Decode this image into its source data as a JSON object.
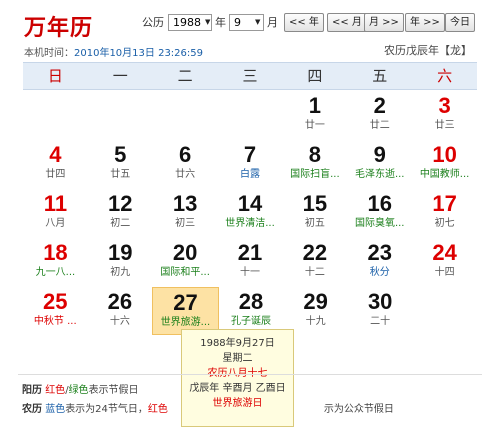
{
  "app": {
    "title": "万年历",
    "now_label": "本机时间：",
    "now_value": "2010年10月13日 23:26:59",
    "lunar_year": "农历戊辰年【龙】"
  },
  "controls": {
    "calendar_label": "公历",
    "year_value": "1988",
    "year_unit": "年",
    "month_value": "9",
    "month_unit": "月",
    "prev_year": "<< 年",
    "next_year": "年 >>",
    "prev_month": "<< 月",
    "next_month": "月 >>",
    "today": "今日"
  },
  "weekdays": [
    "日",
    "一",
    "二",
    "三",
    "四",
    "五",
    "六"
  ],
  "weeks": [
    [
      {
        "d": "",
        "l": ""
      },
      {
        "d": "",
        "l": ""
      },
      {
        "d": "",
        "l": ""
      },
      {
        "d": "",
        "l": ""
      },
      {
        "d": "1",
        "l": "廿一"
      },
      {
        "d": "2",
        "l": "廿二"
      },
      {
        "d": "3",
        "l": "廿三"
      }
    ],
    [
      {
        "d": "4",
        "l": "廿四"
      },
      {
        "d": "5",
        "l": "廿五"
      },
      {
        "d": "6",
        "l": "廿六"
      },
      {
        "d": "7",
        "l": "白露"
      },
      {
        "d": "8",
        "l": "国际扫盲..."
      },
      {
        "d": "9",
        "l": "毛泽东逝..."
      },
      {
        "d": "10",
        "l": "中国教师..."
      }
    ],
    [
      {
        "d": "11",
        "l": "八月"
      },
      {
        "d": "12",
        "l": "初二"
      },
      {
        "d": "13",
        "l": "初三"
      },
      {
        "d": "14",
        "l": "世界清洁..."
      },
      {
        "d": "15",
        "l": "初五"
      },
      {
        "d": "16",
        "l": "国际臭氧..."
      },
      {
        "d": "17",
        "l": "初七"
      }
    ],
    [
      {
        "d": "18",
        "l": "九一八..."
      },
      {
        "d": "19",
        "l": "初九"
      },
      {
        "d": "20",
        "l": "国际和平..."
      },
      {
        "d": "21",
        "l": "十一"
      },
      {
        "d": "22",
        "l": "十二"
      },
      {
        "d": "23",
        "l": "秋分"
      },
      {
        "d": "24",
        "l": "十四"
      }
    ],
    [
      {
        "d": "25",
        "l": "中秋节 ..."
      },
      {
        "d": "26",
        "l": "十六"
      },
      {
        "d": "27",
        "l": "世界旅游..."
      },
      {
        "d": "28",
        "l": "孔子诞辰"
      },
      {
        "d": "29",
        "l": "十九"
      },
      {
        "d": "30",
        "l": "二十"
      },
      {
        "d": "",
        "l": ""
      }
    ]
  ],
  "lunar_colors": {
    "7": "blue",
    "8": "green",
    "9": "green",
    "10": "green",
    "14": "green",
    "16": "green",
    "18": "green",
    "20": "green",
    "23": "blue",
    "25": "red",
    "27": "green",
    "28": "green"
  },
  "tooltip": {
    "date": "1988年9月27日",
    "weekday": "星期二",
    "lunar": "农历八月十七",
    "ganzhi": "戊辰年 辛酉月 乙酉日",
    "festival": "世界旅游日"
  },
  "legend": {
    "solar_label": "阳历",
    "solar_red": "红色",
    "solar_slash": "/",
    "solar_green": "绿色",
    "solar_text": "表示节假日",
    "lunar_label": "农历",
    "lunar_blue": "蓝色",
    "lunar_text1": "表示为24节气日，",
    "lunar_red": "红色",
    "lunar_text2": "示为公众节假日"
  },
  "colors": {
    "red": "#d00",
    "green": "#1a7f1a",
    "blue": "#1a5fa8",
    "highlight": "#fde2a4",
    "header_bg": "#e4edf7"
  }
}
